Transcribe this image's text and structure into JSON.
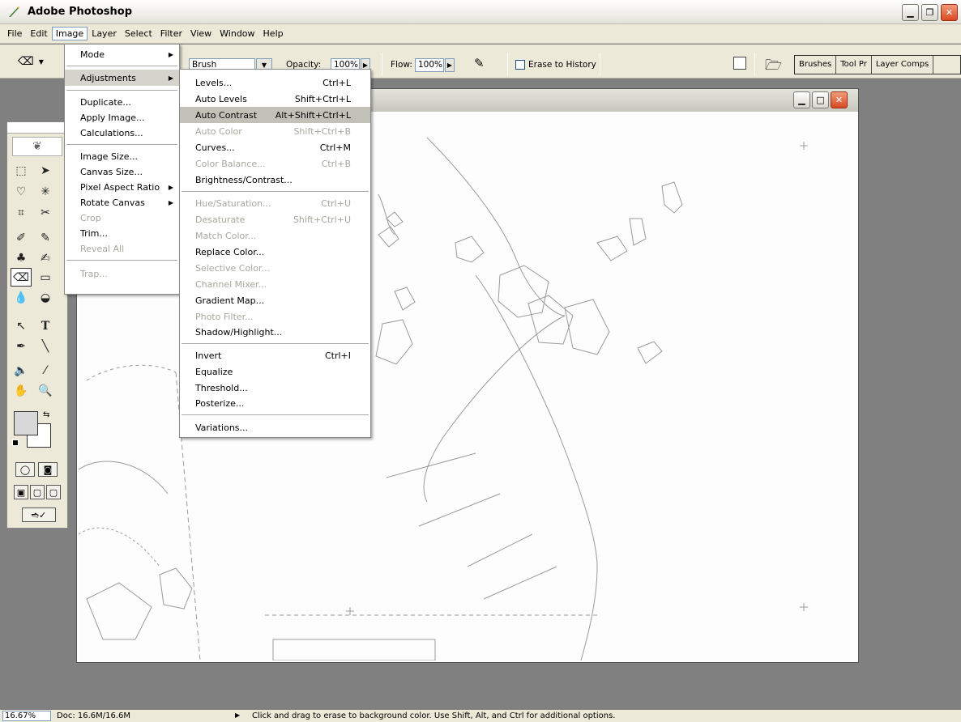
{
  "app": {
    "title": "Adobe Photoshop"
  },
  "menubar": [
    "File",
    "Edit",
    "Image",
    "Layer",
    "Select",
    "Filter",
    "View",
    "Window",
    "Help"
  ],
  "options": {
    "mode_label": "Brush",
    "opacity_label": "Opacity:",
    "opacity_value": "100%",
    "flow_label": "Flow:",
    "flow_value": "100%",
    "erase_to_history": "Erase to History"
  },
  "palette_tabs": [
    "Brushes",
    "Tool Pr",
    "Layer Comps"
  ],
  "image_menu": [
    {
      "label": "Mode",
      "submenu": true
    },
    {
      "sep": true
    },
    {
      "label": "Adjustments",
      "submenu": true,
      "highlight": true
    },
    {
      "sep": true
    },
    {
      "label": "Duplicate..."
    },
    {
      "label": "Apply Image..."
    },
    {
      "label": "Calculations..."
    },
    {
      "sep": true
    },
    {
      "label": "Image Size..."
    },
    {
      "label": "Canvas Size..."
    },
    {
      "label": "Pixel Aspect Ratio",
      "submenu": true
    },
    {
      "label": "Rotate Canvas",
      "submenu": true
    },
    {
      "label": "Crop",
      "disabled": true
    },
    {
      "label": "Trim..."
    },
    {
      "label": "Reveal All",
      "disabled": true
    },
    {
      "sep": true
    },
    {
      "label": "Trap...",
      "disabled": true
    }
  ],
  "adjustments_menu": [
    {
      "label": "Levels...",
      "shortcut": "Ctrl+L"
    },
    {
      "label": "Auto Levels",
      "shortcut": "Shift+Ctrl+L"
    },
    {
      "label": "Auto Contrast",
      "shortcut": "Alt+Shift+Ctrl+L",
      "highlight": true
    },
    {
      "label": "Auto Color",
      "shortcut": "Shift+Ctrl+B",
      "disabled": true
    },
    {
      "label": "Curves...",
      "shortcut": "Ctrl+M"
    },
    {
      "label": "Color Balance...",
      "shortcut": "Ctrl+B",
      "disabled": true
    },
    {
      "label": "Brightness/Contrast..."
    },
    {
      "sep": true
    },
    {
      "label": "Hue/Saturation...",
      "shortcut": "Ctrl+U",
      "disabled": true
    },
    {
      "label": "Desaturate",
      "shortcut": "Shift+Ctrl+U",
      "disabled": true
    },
    {
      "label": "Match Color...",
      "disabled": true
    },
    {
      "label": "Replace Color..."
    },
    {
      "label": "Selective Color...",
      "disabled": true
    },
    {
      "label": "Channel Mixer...",
      "disabled": true
    },
    {
      "label": "Gradient Map..."
    },
    {
      "label": "Photo Filter...",
      "disabled": true
    },
    {
      "label": "Shadow/Highlight..."
    },
    {
      "sep": true
    },
    {
      "label": "Invert",
      "shortcut": "Ctrl+I"
    },
    {
      "label": "Equalize"
    },
    {
      "label": "Threshold..."
    },
    {
      "label": "Posterize..."
    },
    {
      "sep": true
    },
    {
      "label": "Variations..."
    }
  ],
  "status": {
    "zoom": "16.67%",
    "doc": "Doc: 16.6M/16.6M",
    "hint": "Click and drag to erase to background color. Use Shift, Alt, and Ctrl for additional options."
  }
}
